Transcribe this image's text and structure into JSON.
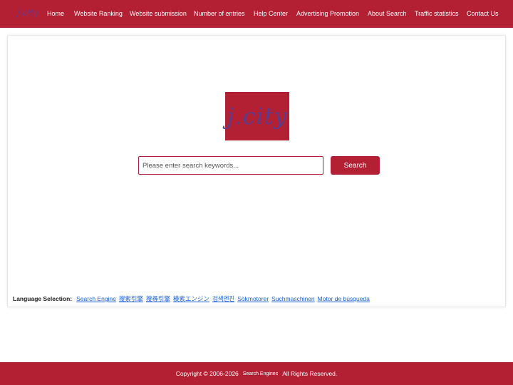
{
  "header": {
    "logo_text": "j.city",
    "nav": [
      {
        "label": "Home"
      },
      {
        "label": "Website Ranking"
      },
      {
        "label": "Website submission"
      },
      {
        "label": "Number of entries"
      },
      {
        "label": "Help Center"
      },
      {
        "label": "Advertising Promotion"
      },
      {
        "label": "About Search"
      },
      {
        "label": "Traffic statistics"
      },
      {
        "label": "Contact Us"
      }
    ]
  },
  "main": {
    "logo_text": "j.city",
    "search": {
      "placeholder": "Please enter search keywords...",
      "value": "",
      "button_label": "Search"
    },
    "language": {
      "label": "Language Selection:",
      "options": [
        "Search Engine",
        "搜索引擎",
        "搜尋引擎",
        "検索エンジン",
        "검색엔진",
        "Sökmotorer",
        "Suchmaschinen",
        "Motor de búsqueda"
      ]
    }
  },
  "footer": {
    "copyright": "Copyright © 2006-2026",
    "brand": "Search Engines",
    "rights": "All Rights Reserved."
  },
  "colors": {
    "brand_red": "#b31f33",
    "link_blue": "#1a5fd6",
    "logo_purple": "#5b3d8c"
  }
}
